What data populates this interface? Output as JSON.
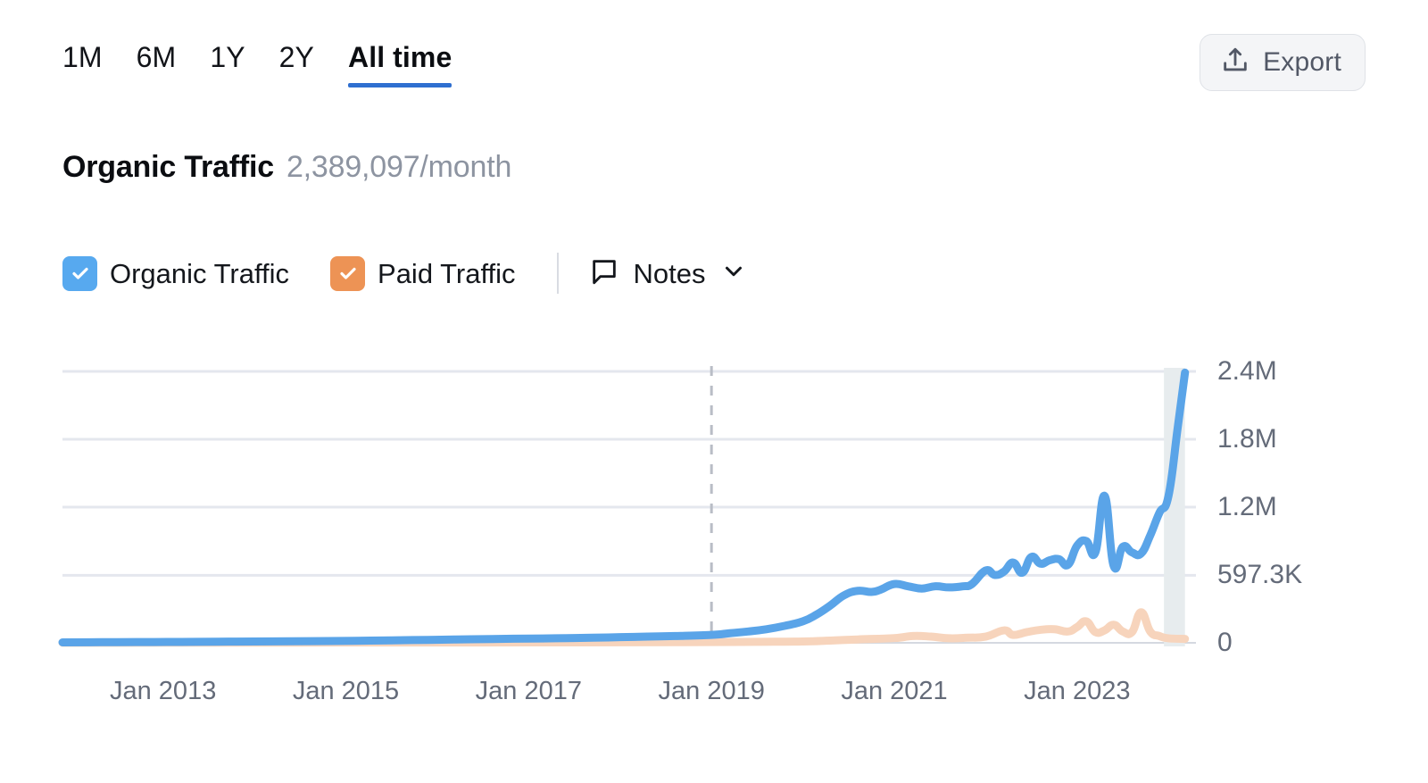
{
  "toolbar": {
    "tabs": [
      {
        "label": "1M",
        "active": false
      },
      {
        "label": "6M",
        "active": false
      },
      {
        "label": "1Y",
        "active": false
      },
      {
        "label": "2Y",
        "active": false
      },
      {
        "label": "All time",
        "active": true
      }
    ],
    "export_label": "Export",
    "export_icon": "upload-icon",
    "active_underline_color": "#2f6fd0"
  },
  "header": {
    "title": "Organic Traffic",
    "value": "2,389,097/month"
  },
  "legend": {
    "items": [
      {
        "label": "Organic Traffic",
        "color": "#57a9ef",
        "checked": true,
        "icon": "checkbox-checked-icon"
      },
      {
        "label": "Paid Traffic",
        "color": "#ed9355",
        "checked": true,
        "icon": "checkbox-checked-icon"
      }
    ],
    "notes": {
      "label": "Notes",
      "icon": "comment-flag-icon",
      "chevron": "chevron-down-icon"
    }
  },
  "chart_data": {
    "type": "line",
    "title": "Organic Traffic",
    "xlabel": "",
    "ylabel": "",
    "grid": true,
    "legend_position": "top",
    "ylim": [
      0,
      2400000
    ],
    "ytick_labels": [
      "2.4M",
      "1.8M",
      "1.2M",
      "597.3K",
      "0"
    ],
    "ytick_values": [
      2400000,
      1800000,
      1200000,
      597300,
      0
    ],
    "xtick_labels": [
      "Jan 2013",
      "Jan 2015",
      "Jan 2017",
      "Jan 2019",
      "Jan 2021",
      "Jan 2023"
    ],
    "xtick_x": [
      2013.0,
      2015.0,
      2017.0,
      2019.0,
      2021.0,
      2023.0
    ],
    "xlim": [
      2011.9,
      2024.3
    ],
    "annotations": [
      {
        "type": "vertical-dashed-line",
        "x": 2019.0,
        "color": "#b9bdc6"
      },
      {
        "type": "shaded-band",
        "x_start": 2023.95,
        "x_end": 2024.18,
        "color": "#e7ecee"
      }
    ],
    "series": [
      {
        "name": "Organic Traffic",
        "color": "#5aa4e8",
        "x": [
          2011.9,
          2012.2,
          2012.5,
          2012.9,
          2013.2,
          2013.6,
          2014.0,
          2014.4,
          2014.8,
          2015.1,
          2015.5,
          2015.9,
          2016.2,
          2016.6,
          2017.0,
          2017.3,
          2017.7,
          2018.0,
          2018.3,
          2018.6,
          2019.0,
          2019.2,
          2019.4,
          2019.6,
          2019.8,
          2020.0,
          2020.15,
          2020.3,
          2020.45,
          2020.6,
          2020.75,
          2020.85,
          2021.0,
          2021.15,
          2021.3,
          2021.45,
          2021.6,
          2021.75,
          2021.85,
          2022.0,
          2022.1,
          2022.2,
          2022.3,
          2022.4,
          2022.5,
          2022.6,
          2022.7,
          2022.8,
          2022.9,
          2023.0,
          2023.1,
          2023.2,
          2023.3,
          2023.4,
          2023.5,
          2023.6,
          2023.7,
          2023.8,
          2023.9,
          2024.0,
          2024.1,
          2024.18
        ],
        "y": [
          4000,
          5000,
          6000,
          7000,
          8000,
          10000,
          12000,
          14000,
          16000,
          18000,
          22000,
          26000,
          30000,
          34000,
          38000,
          40000,
          45000,
          50000,
          55000,
          60000,
          70000,
          85000,
          100000,
          120000,
          150000,
          190000,
          250000,
          330000,
          420000,
          460000,
          450000,
          470000,
          520000,
          500000,
          480000,
          500000,
          490000,
          500000,
          520000,
          640000,
          600000,
          630000,
          710000,
          620000,
          760000,
          700000,
          730000,
          740000,
          690000,
          860000,
          900000,
          800000,
          1300000,
          680000,
          850000,
          800000,
          790000,
          950000,
          1150000,
          1300000,
          1900000,
          2389097
        ]
      },
      {
        "name": "Paid Traffic",
        "color": "#f7d4bc",
        "x": [
          2011.9,
          2013.0,
          2014.0,
          2015.0,
          2016.0,
          2017.0,
          2018.0,
          2019.0,
          2019.5,
          2020.0,
          2020.3,
          2020.6,
          2021.0,
          2021.2,
          2021.4,
          2021.6,
          2021.8,
          2022.0,
          2022.2,
          2022.3,
          2022.45,
          2022.6,
          2022.75,
          2022.9,
          2023.0,
          2023.1,
          2023.2,
          2023.3,
          2023.4,
          2023.5,
          2023.6,
          2023.7,
          2023.8,
          2023.9,
          2024.0,
          2024.18
        ],
        "y": [
          1000,
          1500,
          2000,
          2500,
          3000,
          4000,
          5000,
          7000,
          9000,
          12000,
          20000,
          30000,
          42000,
          60000,
          55000,
          40000,
          45000,
          55000,
          110000,
          70000,
          95000,
          115000,
          120000,
          100000,
          140000,
          190000,
          95000,
          110000,
          160000,
          100000,
          95000,
          270000,
          100000,
          60000,
          40000,
          35000
        ]
      }
    ]
  }
}
